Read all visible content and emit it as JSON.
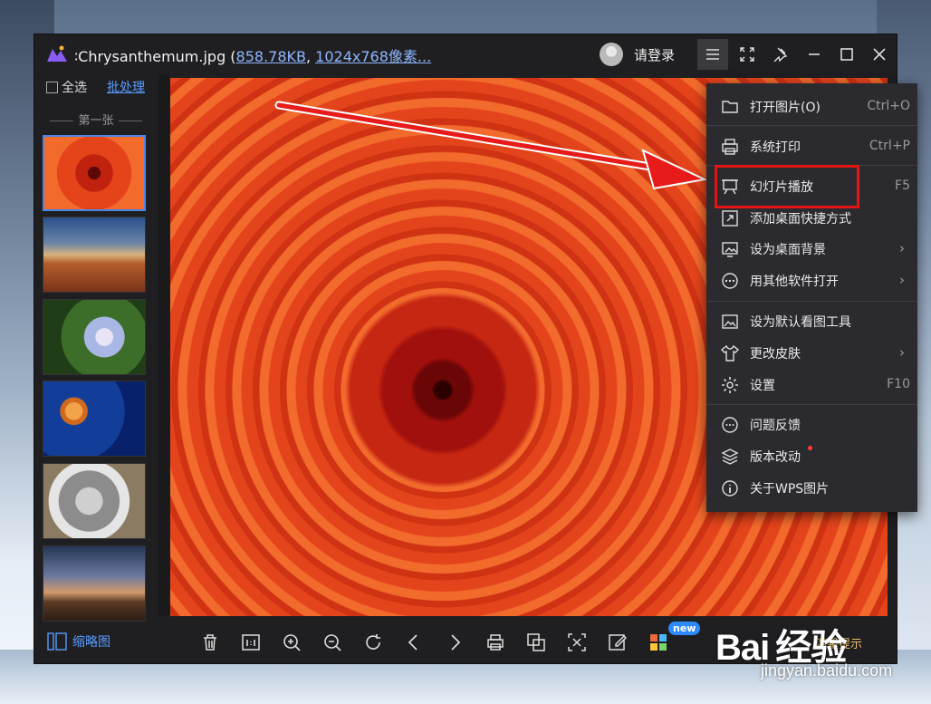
{
  "window": {
    "title_prefix": "∶Chrysanthemum.jpg (",
    "file_size": "858.78KB",
    "title_sep": ", ",
    "dimensions": "1024x768像素...",
    "login": "请登录"
  },
  "sidebar": {
    "select_all": "全选",
    "batch": "批处理",
    "first_label": "第一张",
    "thumbnails": [
      "Chrysanthemum",
      "Desert",
      "Hydrangeas",
      "Jellyfish",
      "Koala",
      "Lighthouse"
    ]
  },
  "menu": {
    "items": [
      {
        "label": "打开图片(O)",
        "shortcut": "Ctrl+O",
        "icon": "folder-icon"
      },
      {
        "label": "系统打印",
        "shortcut": "Ctrl+P",
        "icon": "printer-icon"
      },
      {
        "label": "幻灯片播放",
        "shortcut": "F5",
        "icon": "slideshow-icon"
      },
      {
        "label": "添加桌面快捷方式",
        "shortcut": "",
        "icon": "shortcut-icon"
      },
      {
        "label": "设为桌面背景",
        "shortcut": "",
        "icon": "wallpaper-icon"
      },
      {
        "label": "用其他软件打开",
        "shortcut": "",
        "icon": "more-icon"
      },
      {
        "label": "设为默认看图工具",
        "shortcut": "",
        "icon": "image-icon"
      },
      {
        "label": "更改皮肤",
        "shortcut": "",
        "icon": "shirt-icon"
      },
      {
        "label": "设置",
        "shortcut": "F10",
        "icon": "gear-icon"
      },
      {
        "label": "问题反馈",
        "shortcut": "",
        "icon": "chat-icon"
      },
      {
        "label": "版本改动",
        "shortcut": "",
        "icon": "layers-icon"
      },
      {
        "label": "关于WPS图片",
        "shortcut": "",
        "icon": "info-icon"
      }
    ],
    "chevron": "›"
  },
  "bottombar": {
    "thumbs_label": "缩略图",
    "new_badge": "new",
    "tip": "温馨提示"
  },
  "watermark": {
    "brand": "Bai 经验",
    "site": "jingyan.baidu.com"
  },
  "colors": {
    "accent": "#4a86e8",
    "link": "#5a9bff",
    "highlight": "#e21414",
    "menu_bg": "#2b2b2f"
  }
}
